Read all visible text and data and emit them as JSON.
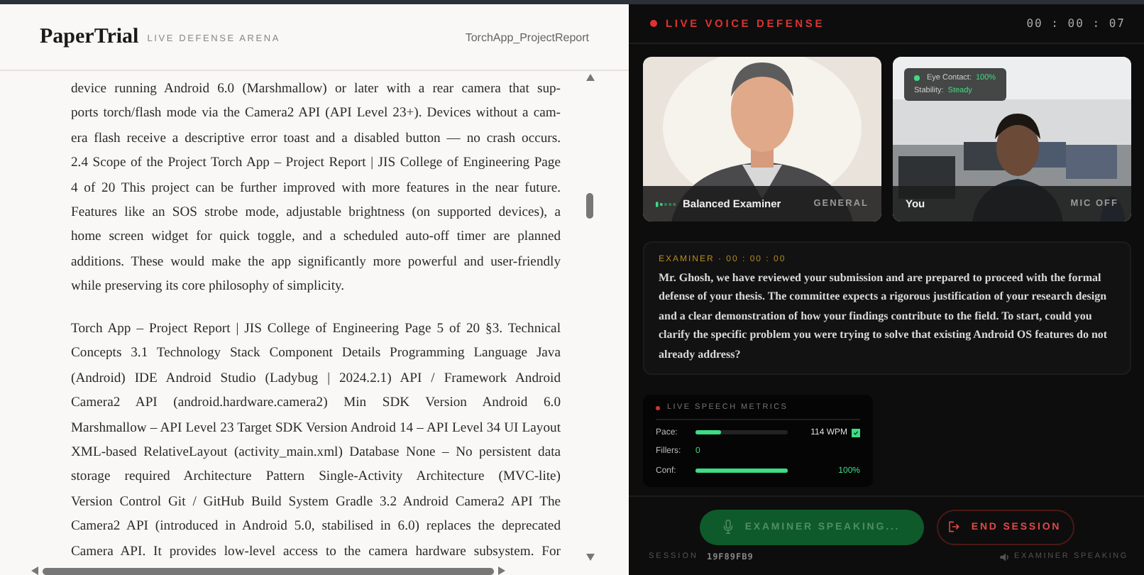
{
  "document": {
    "brand": "PaperTrial",
    "subtitle": "LIVE DEFENSE ARENA",
    "file_name": "TorchApp_ProjectReport",
    "paragraphs": [
      {
        "lines": [
          "device running Android 6.0 (Marshmallow) or later with a rear camera that sup-",
          "ports torch/flash mode via the Camera2 API (API Level 23+). Devices without a cam-",
          "era flash receive a descriptive error toast and a disabled button — no crash occurs.",
          "2.4 Scope of the Project Torch App – Project Report | JIS College of Engineering Page",
          "4 of 20 This project can be further improved with more features in the near future.",
          "Features like an SOS strobe mode, adjustable brightness (on supported devices), a",
          "home screen widget for quick toggle, and a scheduled auto-off timer are planned",
          "additions. These would make the app significantly more powerful and user-friendly",
          "while preserving its core philosophy of simplicity."
        ]
      },
      {
        "lines": [
          "Torch App – Project Report | JIS College of Engineering Page 5 of 20 §3. Technical",
          "Concepts 3.1 Technology Stack Component Details Programming Language Java",
          "(Android) IDE Android Studio (Ladybug | 2024.2.1) API / Framework Android",
          "Camera2 API (android.hardware.camera2) Min SDK Version Android 6.0",
          "Marshmallow – API Level 23 Target SDK Version Android 14 – API Level 34 UI Layout",
          "XML-based RelativeLayout (activity_main.xml) Database None – No persistent data",
          "storage required Architecture Pattern Single-Activity Architecture (MVC-lite)",
          "Version Control Git / GitHub Build System Gradle 3.2 Android Camera2 API The",
          "Camera2 API (introduced in Android 5.0, stabilised in 6.0) replaces the deprecated",
          "Camera API. It provides low-level access to the camera hardware subsystem. For"
        ]
      }
    ]
  },
  "session": {
    "status": "LIVE VOICE DEFENSE",
    "timer": "00 : 00 : 07",
    "tiles": [
      {
        "kind": "examiner",
        "name": "Balanced Examiner",
        "tag": "GENERAL",
        "speaking": true
      },
      {
        "kind": "candidate",
        "name": "You",
        "tag": "MIC OFF",
        "speaking": false,
        "overlay": {
          "eye_label": "Eye Contact:",
          "eye_value": "100%",
          "stability_label": "Stability:",
          "stability_value": "Steady"
        }
      }
    ],
    "transcript": {
      "speaker": "EXAMINER · 00 : 00 : 00",
      "text": "Mr. Ghosh, we have reviewed your submission and are prepared to proceed with the formal defense of your thesis. The committee expects a rigorous justification of your research design and a clear demonstration of how your findings contribute to the field. To start, could you clarify the specific problem you were trying to solve that existing Android OS features do not already address?"
    },
    "metrics": {
      "title": "LIVE SPEECH METRICS",
      "rows": [
        {
          "kind": "bar",
          "label": "Pace:",
          "level": 0.27,
          "reading": "114 WPM",
          "checked": true
        },
        {
          "kind": "count",
          "label": "Fillers:",
          "reading": "0"
        },
        {
          "kind": "bar",
          "label": "Conf:",
          "level": 1,
          "reading": "100%"
        }
      ]
    },
    "buttons": [
      {
        "kind": "speaking",
        "label": "EXAMINER SPEAKING...",
        "disabled": true
      },
      {
        "kind": "end",
        "label": "END SESSION",
        "disabled": false
      }
    ],
    "footer": {
      "session_label": "SESSION",
      "session_id": "19F89FB9",
      "status": "EXAMINER SPEAKING"
    }
  }
}
